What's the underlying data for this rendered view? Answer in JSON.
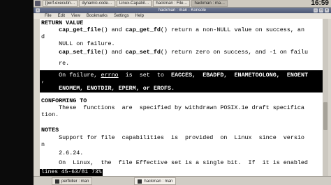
{
  "taskbar": {
    "tasks": [
      "[perf-executin…",
      "dynamic-code…",
      "Linux-Capabil…",
      "hackman : File…",
      "hackman : ma…"
    ],
    "clock": "16:59"
  },
  "window": {
    "title": "hackman : man - Konsole"
  },
  "menu": [
    "File",
    "Edit",
    "View",
    "Bookmarks",
    "Settings",
    "Help"
  ],
  "terminal": {
    "lines": [
      {
        "text": "RETURN VALUE",
        "bold": true
      },
      {
        "pre": "     ",
        "b1": "cap_get_file",
        "mid": "() and ",
        "b2": "cap_get_fd",
        "post": "() return a non-NULL value on success, an"
      },
      {
        "pre": "d",
        "b1": "",
        "mid": "",
        "b2": "",
        "post": ""
      },
      {
        "pre": "     NULL on failure.",
        "b1": "",
        "mid": "",
        "b2": "",
        "post": ""
      },
      {
        "pre": "     ",
        "b1": "cap_set_file",
        "mid": "() and ",
        "b2": "cap_set_fd",
        "post": "() return zero on success, and -1 on failu"
      },
      {
        "pre": "     re.",
        "b1": "",
        "mid": "",
        "b2": "",
        "post": ""
      }
    ],
    "highlight": {
      "line1_pre": "     On failure, ",
      "line1_var": "errno",
      "line1_post": "  is  set  to  ",
      "line1_codes": "EACCES,  EBADFD,  ENAMETOOLONG,  ENOENT",
      "line2": ",",
      "line3": "     ENOMEM, ENOTDIR, EPERM, or EROFS."
    },
    "conforming": {
      "heading": "CONFORMING TO",
      "line1": "     These  functions  are  specified by withdrawn POSIX.1e draft specifica",
      "line2": "tion."
    },
    "notes": {
      "heading": "NOTES",
      "line1": "     Support for file  capabilities  is  provided  on  Linux  since  versio",
      "line2": "n",
      "line3": "     2.6.24.",
      "line4": "     On  Linux,  the  file Effective set is a single bit.  If  it is enabled"
    },
    "status": "lines 45-63/81 73%"
  },
  "bottom_tabs": [
    "perfkiller : man",
    "hackman : man"
  ]
}
